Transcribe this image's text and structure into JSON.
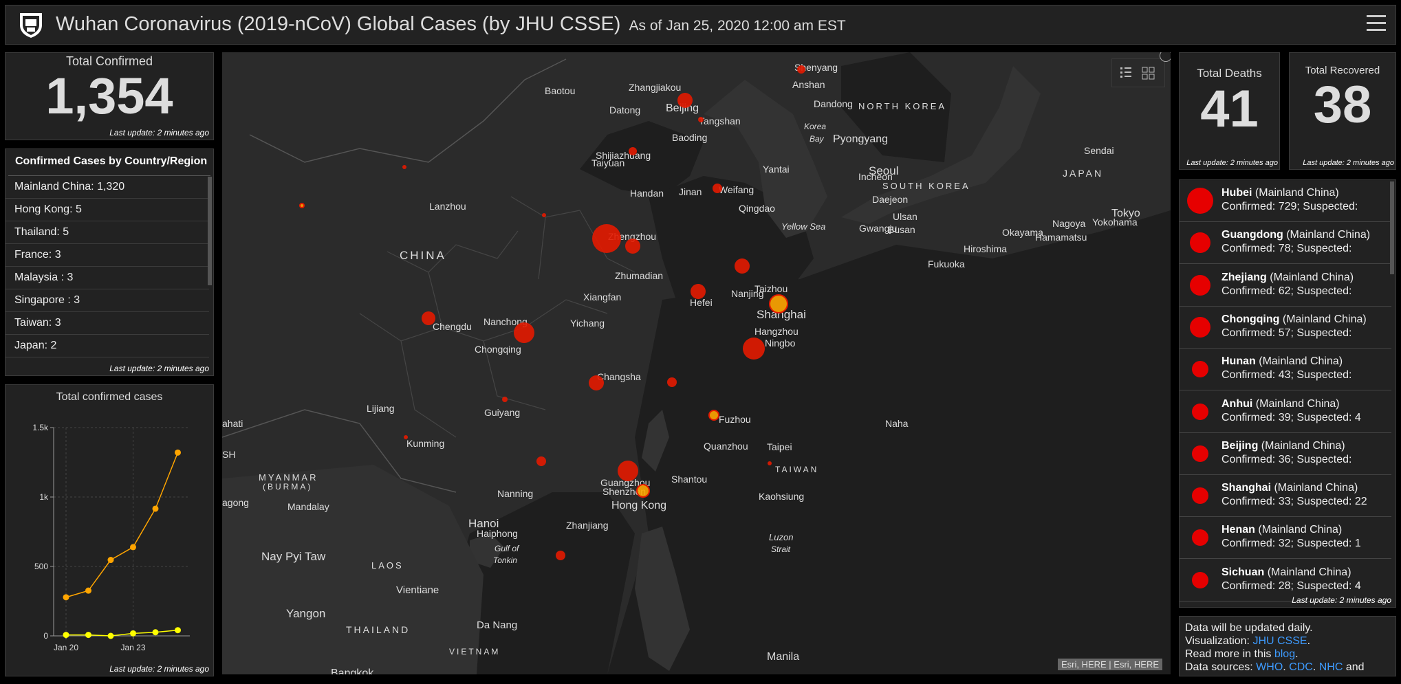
{
  "header": {
    "title": "Wuhan Coronavirus (2019-nCoV) Global Cases (by JHU CSSE)",
    "as_of": "As of Jan 25, 2020 12:00 am EST"
  },
  "total_confirmed": {
    "label": "Total Confirmed",
    "value": "1,354",
    "updated": "Last update: 2 minutes ago"
  },
  "country_list": {
    "title": "Confirmed Cases by Country/Region",
    "items": [
      "Mainland China:  1,320",
      "Hong Kong:  5",
      "Thailand:  5",
      "France:  3",
      "Malaysia :  3",
      "Singapore :  3",
      "Taiwan:  3",
      "Japan:  2"
    ],
    "updated": "Last update: 2 minutes ago"
  },
  "chart_panel": {
    "title": "Total confirmed cases",
    "updated": "Last update: 2 minutes ago"
  },
  "chart_data": {
    "type": "line",
    "title": "Total confirmed cases",
    "x": [
      "Jan 20",
      "Jan 21",
      "Jan 22",
      "Jan 23",
      "Jan 24",
      "Jan 25"
    ],
    "xticks": [
      "Jan 20",
      "Jan 23"
    ],
    "yticks": [
      "0",
      "500",
      "1k",
      "1.5k"
    ],
    "ylim": [
      0,
      1500
    ],
    "series": [
      {
        "values": [
          278,
          326,
          547,
          639,
          916,
          1320
        ],
        "color": "#ffa500"
      },
      {
        "values": [
          7,
          7,
          0,
          18,
          26,
          41
        ],
        "color": "#ffff00"
      }
    ],
    "grid": true
  },
  "map": {
    "attribution": "Esri, HERE | Esri, HERE",
    "labels": [
      {
        "t": "Shenyang"
      },
      {
        "t": "Anshan"
      },
      {
        "t": "Baotou"
      },
      {
        "t": "Zhangjiakou"
      },
      {
        "t": "Beijing"
      },
      {
        "t": "Datong"
      },
      {
        "t": "Tangshan"
      },
      {
        "t": "Dandong"
      },
      {
        "t": "NORTH KOREA"
      },
      {
        "t": "Korea"
      },
      {
        "t": "Bay"
      },
      {
        "t": "Pyongyang"
      },
      {
        "t": "Baoding"
      },
      {
        "t": "Shijiazhuang"
      },
      {
        "t": "Taiyuan"
      },
      {
        "t": "Seoul"
      },
      {
        "t": "Incheon"
      },
      {
        "t": "SOUTH KOREA"
      },
      {
        "t": "Daejeon"
      },
      {
        "t": "Yantai"
      },
      {
        "t": "Handan"
      },
      {
        "t": "Jinan"
      },
      {
        "t": "Weifang"
      },
      {
        "t": "Qingdao"
      },
      {
        "t": "Sendai"
      },
      {
        "t": "JAPAN"
      },
      {
        "t": "Lanzhou"
      },
      {
        "t": "Yellow Sea"
      },
      {
        "t": "Gwangju"
      },
      {
        "t": "Ulsan"
      },
      {
        "t": "Busan"
      },
      {
        "t": "Tokyo"
      },
      {
        "t": "Yokohama"
      },
      {
        "t": "Nagoya"
      },
      {
        "t": "Okayama"
      },
      {
        "t": "Hamamatsu"
      },
      {
        "t": "Zhengzhou"
      },
      {
        "t": "Hiroshima"
      },
      {
        "t": "CHINA"
      },
      {
        "t": "Fukuoka"
      },
      {
        "t": "Zhumadian"
      },
      {
        "t": "Taizhou"
      },
      {
        "t": "Xiangfan"
      },
      {
        "t": "Nanjing"
      },
      {
        "t": "Hefei"
      },
      {
        "t": "Shanghai"
      },
      {
        "t": "Nanchong"
      },
      {
        "t": "Yichang"
      },
      {
        "t": "Chengdu"
      },
      {
        "t": "Hangzhou"
      },
      {
        "t": "Ningbo"
      },
      {
        "t": "Chongqing"
      },
      {
        "t": "Changsha"
      },
      {
        "t": "Lijiang"
      },
      {
        "t": "Guiyang"
      },
      {
        "t": "Naha"
      },
      {
        "t": "Fuzhou"
      },
      {
        "t": "ahati"
      },
      {
        "t": "Kunming"
      },
      {
        "t": "Taipei"
      },
      {
        "t": "Quanzhou"
      },
      {
        "t": "SH"
      },
      {
        "t": "MYANMAR"
      },
      {
        "t": "(BURMA)"
      },
      {
        "t": "TAIWAN"
      },
      {
        "t": "Shantou"
      },
      {
        "t": "Nanning"
      },
      {
        "t": "Guangzhou"
      },
      {
        "t": "agong"
      },
      {
        "t": "Shenzhen"
      },
      {
        "t": "Kaohsiung"
      },
      {
        "t": "Mandalay"
      },
      {
        "t": "Hong Kong"
      },
      {
        "t": "Hanoi"
      },
      {
        "t": "Zhanjiang"
      },
      {
        "t": "Haiphong"
      },
      {
        "t": "Luzon"
      },
      {
        "t": "Strait"
      },
      {
        "t": "Nay Pyi Taw"
      },
      {
        "t": "Gulf of"
      },
      {
        "t": "Tonkin"
      },
      {
        "t": "LAOS"
      },
      {
        "t": "Vientiane"
      },
      {
        "t": "Yangon"
      },
      {
        "t": "THAILAND"
      },
      {
        "t": "Da Nang"
      },
      {
        "t": "Manila"
      },
      {
        "t": "VIETNAM"
      },
      {
        "t": "Bangkok"
      }
    ]
  },
  "total_deaths": {
    "label": "Total Deaths",
    "value": "41",
    "updated": "Last update: 2 minutes ago"
  },
  "total_recovered": {
    "label": "Total Recovered",
    "value": "38",
    "updated": "Last update: 2 minutes ago"
  },
  "provinces": {
    "items": [
      {
        "name": "Hubei",
        "region": "(Mainland China)",
        "detail": "Confirmed: 729; Suspected:"
      },
      {
        "name": "Guangdong",
        "region": "(Mainland China)",
        "detail": "Confirmed: 78; Suspected:"
      },
      {
        "name": "Zhejiang",
        "region": "(Mainland China)",
        "detail": "Confirmed: 62; Suspected:"
      },
      {
        "name": "Chongqing",
        "region": "(Mainland China)",
        "detail": "Confirmed: 57; Suspected:"
      },
      {
        "name": "Hunan",
        "region": "(Mainland China)",
        "detail": "Confirmed: 43; Suspected:"
      },
      {
        "name": "Anhui",
        "region": "(Mainland China)",
        "detail": "Confirmed: 39; Suspected: 4"
      },
      {
        "name": "Beijing",
        "region": "(Mainland China)",
        "detail": "Confirmed: 36; Suspected:"
      },
      {
        "name": "Shanghai",
        "region": "(Mainland China)",
        "detail": "Confirmed: 33; Suspected: 22"
      },
      {
        "name": "Henan",
        "region": "(Mainland China)",
        "detail": "Confirmed: 32; Suspected: 1"
      },
      {
        "name": "Sichuan",
        "region": "(Mainland China)",
        "detail": "Confirmed: 28; Suspected: 4"
      }
    ],
    "updated": "Last update: 2 minutes ago"
  },
  "info": {
    "line1": "Data will be updated daily.",
    "viz_prefix": "Visualization: ",
    "viz_link": "JHU CSSE",
    "read_prefix": "Read more in this ",
    "read_link": "blog",
    "sources_prefix": "Data sources: ",
    "src1": "WHO",
    "src2": "CDC",
    "src3": "NHC",
    "sources_suffix": " and"
  },
  "colors": {
    "accent": "#e60000",
    "link": "#3d9bff",
    "series1": "#ffa500",
    "series2": "#ffff00"
  }
}
